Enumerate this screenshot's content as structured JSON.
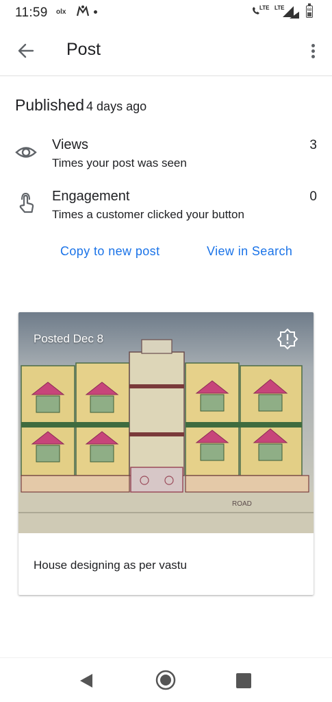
{
  "status_bar": {
    "time": "11:59",
    "olx": "olx",
    "lte_1": "LTE",
    "lte_2": "LTE",
    "battery": "68"
  },
  "app_bar": {
    "title": "Post",
    "back_icon": "arrow-back-icon",
    "menu_icon": "more-vert-icon"
  },
  "published": {
    "label": "Published",
    "ago": "4 days ago"
  },
  "stats": [
    {
      "icon": "eye-icon",
      "title": "Views",
      "subtitle": "Times your post was seen",
      "value": "3"
    },
    {
      "icon": "touch-icon",
      "title": "Engagement",
      "subtitle": "Times a customer clicked your button",
      "value": "0"
    }
  ],
  "actions": {
    "copy": "Copy to new post",
    "view": "View in Search"
  },
  "post": {
    "posted": "Posted Dec 8",
    "text": "House designing as per vastu",
    "image_caption": "ROAD"
  },
  "colors": {
    "link": "#1a73e8",
    "text": "#202124",
    "icon": "#5f6368"
  }
}
